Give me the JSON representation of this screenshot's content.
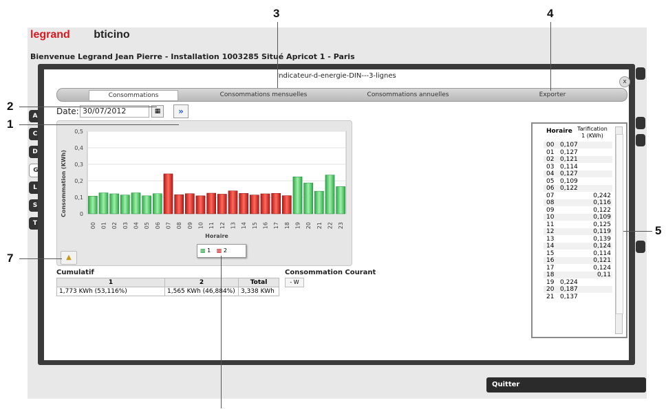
{
  "callouts": [
    "3",
    "4",
    "2",
    "1",
    "5",
    "7"
  ],
  "header": {
    "brand_left": "legrand",
    "brand_right": "bticino",
    "welcome": "Bienvenue Legrand Jean Pierre - Installation 1003285 Situé Apricot 1 - Paris"
  },
  "side_buttons": [
    "A",
    "C",
    "D",
    "G",
    "L",
    "S",
    "T"
  ],
  "dialog": {
    "title": "Indicateur-d-energie-DIN---3-lignes",
    "close": "x"
  },
  "tabs": [
    "Consommations",
    "Consommations mensuelles",
    "Consommations annuelles",
    "Exporter"
  ],
  "date": {
    "label": "Date:",
    "value": "30/07/2012",
    "next": "»"
  },
  "chart_data": {
    "type": "bar",
    "ylabel": "Consommation (KWh)",
    "xlabel": "Horaire",
    "ylim": [
      0,
      0.5
    ],
    "yticks": [
      "0",
      "0,1",
      "0,2",
      "0,3",
      "0,4",
      "0,5"
    ],
    "categories": [
      "00",
      "01",
      "02",
      "03",
      "04",
      "05",
      "06",
      "07",
      "08",
      "09",
      "10",
      "11",
      "12",
      "13",
      "14",
      "15",
      "16",
      "17",
      "18",
      "19",
      "20",
      "21",
      "22",
      "23"
    ],
    "values": [
      0.107,
      0.127,
      0.121,
      0.114,
      0.127,
      0.109,
      0.122,
      0.242,
      0.116,
      0.122,
      0.109,
      0.125,
      0.119,
      0.139,
      0.124,
      0.114,
      0.121,
      0.124,
      0.11,
      0.224,
      0.187,
      0.137,
      0.235,
      0.165
    ],
    "tariff": [
      1,
      1,
      1,
      1,
      1,
      1,
      1,
      2,
      2,
      2,
      2,
      2,
      2,
      2,
      2,
      2,
      2,
      2,
      2,
      1,
      1,
      1,
      1,
      1
    ],
    "legend": [
      "1",
      "2"
    ],
    "colors": {
      "tariff1": "#3fbf5a",
      "tariff2": "#d42a2a"
    }
  },
  "cumulatif": {
    "title": "Cumulatif",
    "headers": [
      "1",
      "2",
      "Total"
    ],
    "values": [
      "1,773 KWh (53,116%)",
      "1,565 KWh (46,884%)",
      "3,338 KWh"
    ]
  },
  "courant": {
    "title": "Consommation Courant",
    "value": "- W"
  },
  "hourly": {
    "col_hour": "Horaire",
    "col_tariff": "Tarification 1 (KWh)",
    "rows": [
      {
        "h": "00",
        "v": "0,107",
        "t": 1
      },
      {
        "h": "01",
        "v": "0,127",
        "t": 1
      },
      {
        "h": "02",
        "v": "0,121",
        "t": 1
      },
      {
        "h": "03",
        "v": "0,114",
        "t": 1
      },
      {
        "h": "04",
        "v": "0,127",
        "t": 1
      },
      {
        "h": "05",
        "v": "0,109",
        "t": 1
      },
      {
        "h": "06",
        "v": "0,122",
        "t": 1
      },
      {
        "h": "07",
        "v": "0,242",
        "t": 2
      },
      {
        "h": "08",
        "v": "0,116",
        "t": 2
      },
      {
        "h": "09",
        "v": "0,122",
        "t": 2
      },
      {
        "h": "10",
        "v": "0,109",
        "t": 2
      },
      {
        "h": "11",
        "v": "0,125",
        "t": 2
      },
      {
        "h": "12",
        "v": "0,119",
        "t": 2
      },
      {
        "h": "13",
        "v": "0,139",
        "t": 2
      },
      {
        "h": "14",
        "v": "0,124",
        "t": 2
      },
      {
        "h": "15",
        "v": "0,114",
        "t": 2
      },
      {
        "h": "16",
        "v": "0,121",
        "t": 2
      },
      {
        "h": "17",
        "v": "0,124",
        "t": 2
      },
      {
        "h": "18",
        "v": "0,11",
        "t": 2
      },
      {
        "h": "19",
        "v": "0,224",
        "t": 1
      },
      {
        "h": "20",
        "v": "0,187",
        "t": 1
      },
      {
        "h": "21",
        "v": "0,137",
        "t": 1
      }
    ]
  },
  "quit": "Quitter"
}
